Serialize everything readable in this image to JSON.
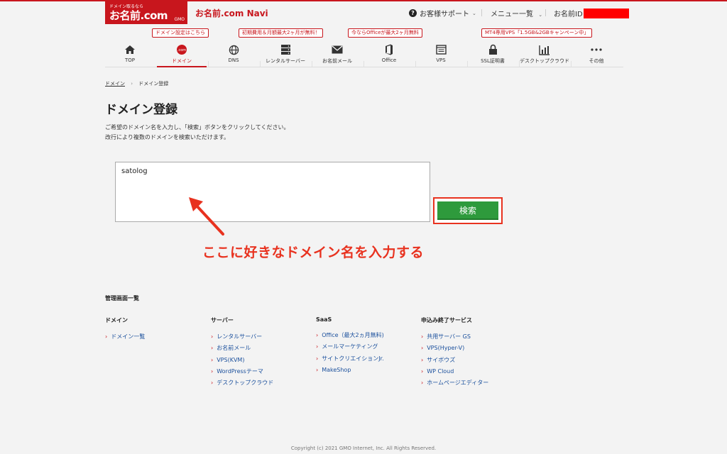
{
  "header": {
    "logo_tagline": "ドメイン取るなら",
    "logo_text": "お名前.com",
    "logo_gmo": "GMO",
    "navi_title": "お名前.com Navi",
    "support_label": "お客様サポート",
    "menu_label": "メニュー一覧",
    "user_id_label": "お名前ID"
  },
  "promos": {
    "domain": "ドメイン設定はこちら",
    "rental": "初期費用＆月額最大2ヶ月が無料！",
    "office": "今ならOfficeが最大2ヶ月無料",
    "vps": "MT4専用VPS「1.5GB&2GBキャンペーン中」"
  },
  "nav": {
    "items": [
      {
        "label": "TOP",
        "icon": "home-icon"
      },
      {
        "label": "ドメイン",
        "icon": "dotcom-icon"
      },
      {
        "label": "DNS",
        "icon": "globe-icon"
      },
      {
        "label": "レンタルサーバー",
        "icon": "server-icon"
      },
      {
        "label": "お名前メール",
        "icon": "mail-icon"
      },
      {
        "label": "Office",
        "icon": "office-icon"
      },
      {
        "label": "VPS",
        "icon": "vps-icon"
      },
      {
        "label": "SSL証明書",
        "icon": "lock-icon"
      },
      {
        "label": "デスクトップクラウド",
        "icon": "chart-icon"
      },
      {
        "label": "その他",
        "icon": "more-icon"
      }
    ],
    "dotcom_badge": ".com"
  },
  "breadcrumb": {
    "parent": "ドメイン",
    "separator": "›",
    "current": "ドメイン登録"
  },
  "page": {
    "title": "ドメイン登録",
    "desc_line1": "ご希望のドメイン名を入力し、「検索」ボタンをクリックしてください。",
    "desc_line2": "改行により複数のドメインを検索いただけます。"
  },
  "form": {
    "domain_value": "satolog",
    "search_label": "検索"
  },
  "annotation": {
    "text": "ここに好きなドメイン名を入力する",
    "color": "#e8321f"
  },
  "management": {
    "title": "管理画面一覧",
    "columns": [
      {
        "heading": "ドメイン",
        "links": [
          "ドメイン一覧"
        ]
      },
      {
        "heading": "サーバー",
        "links": [
          "レンタルサーバー",
          "お名前メール",
          "VPS(KVM)",
          "WordPressテーマ",
          "デスクトップクラウド"
        ]
      },
      {
        "heading": "SaaS",
        "links": [
          "Office（最大2ヵ月無料)",
          "メールマーケティング",
          "サイトクリエイションJr.",
          "MakeShop"
        ]
      },
      {
        "heading": "申込み終了サービス",
        "links": [
          "共用サーバー GS",
          "VPS(Hyper-V)",
          "サイボウズ",
          "WP Cloud",
          "ホームページエディター"
        ]
      }
    ],
    "chevron": "›"
  },
  "footer": {
    "copyright": "Copyright (c) 2021 GMO Internet, Inc. All Rights Reserved."
  },
  "colors": {
    "brand_red": "#c8161d",
    "search_green": "#2e9a3c",
    "link_blue": "#1a4f9c",
    "highlight_red": "#e8321f"
  }
}
